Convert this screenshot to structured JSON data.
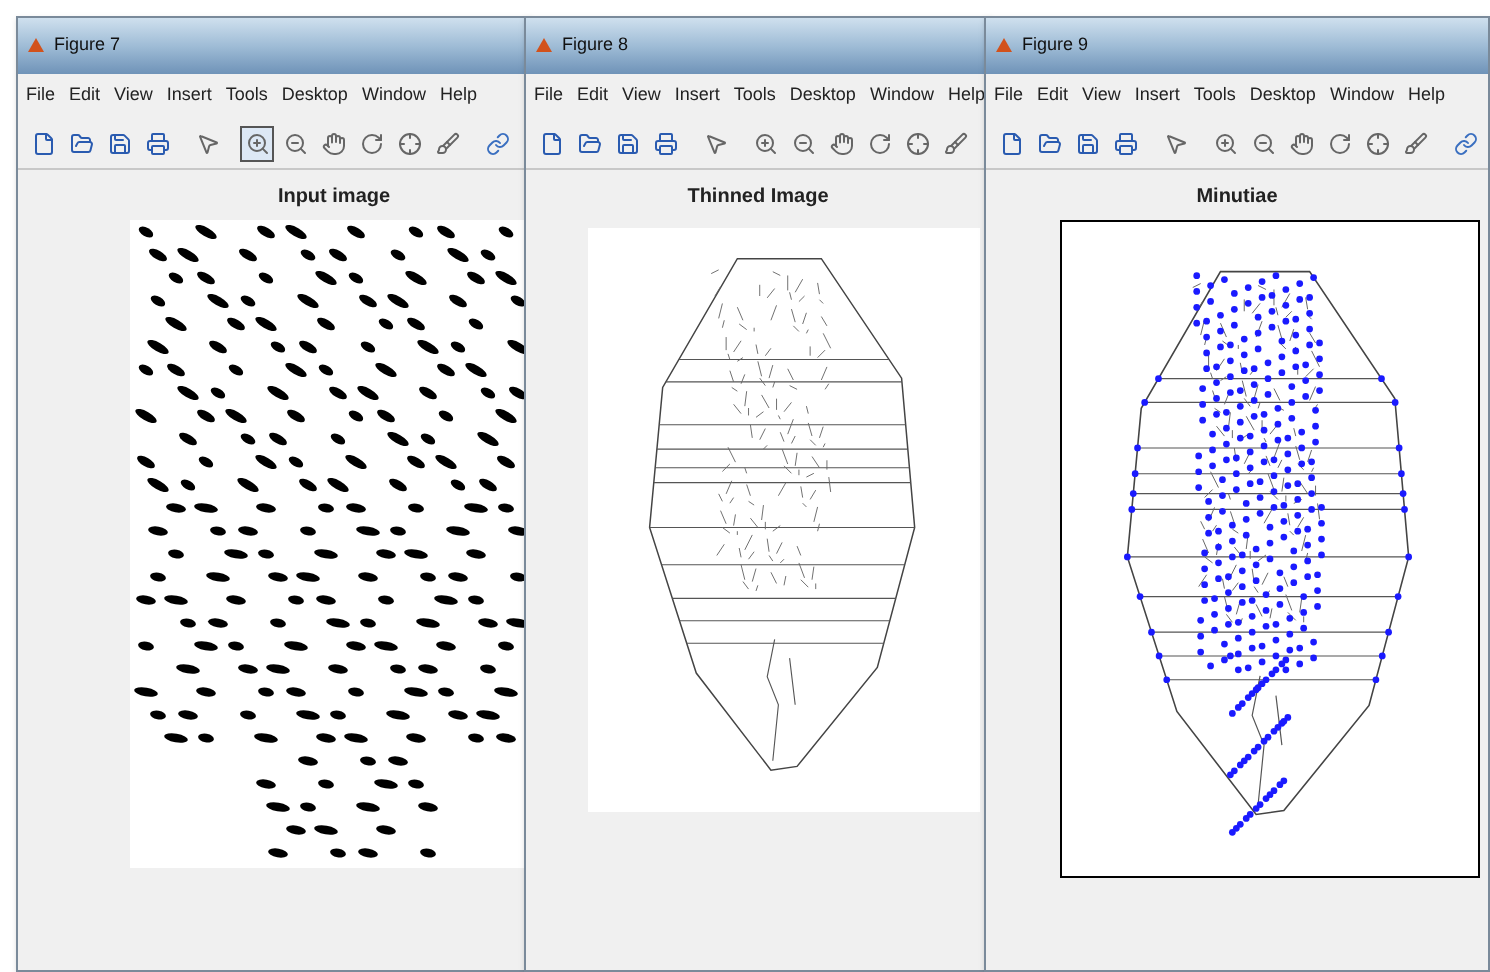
{
  "windows": [
    {
      "title": "Figure 7",
      "menu": [
        "File",
        "Edit",
        "View",
        "Insert",
        "Tools",
        "Desktop",
        "Window",
        "Help"
      ],
      "zoom_in_pressed": true,
      "plot_title": "Input image",
      "kind": "input"
    },
    {
      "title": "Figure 8",
      "menu": [
        "File",
        "Edit",
        "View",
        "Insert",
        "Tools",
        "Desktop",
        "Window",
        "Help"
      ],
      "zoom_in_pressed": false,
      "plot_title": "Thinned Image",
      "kind": "thinned"
    },
    {
      "title": "Figure 9",
      "menu": [
        "File",
        "Edit",
        "View",
        "Insert",
        "Tools",
        "Desktop",
        "Window",
        "Help"
      ],
      "zoom_in_pressed": false,
      "plot_title": "Minutiae",
      "kind": "minutiae"
    }
  ]
}
